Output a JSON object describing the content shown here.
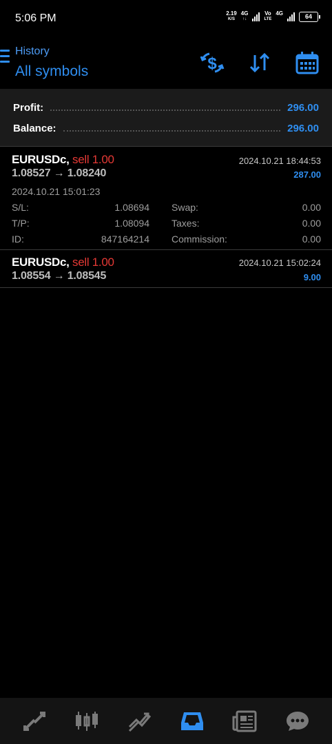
{
  "status": {
    "time": "5:06 PM",
    "speed_value": "2.19",
    "speed_unit": "K/S",
    "net1": "4G",
    "net2_top": "Vo",
    "net2_bottom": "LTE",
    "net3": "4G",
    "battery": "64"
  },
  "header": {
    "subtitle": "History",
    "title": "All symbols",
    "icons": [
      "dollar-exchange-icon",
      "sort-icon",
      "calendar-icon"
    ]
  },
  "summary": {
    "profit_label": "Profit:",
    "profit_value": "296.00",
    "balance_label": "Balance:",
    "balance_value": "296.00"
  },
  "trades": [
    {
      "symbol": "EURUSDc,",
      "side": "sell 1.00",
      "close_time": "2024.10.21 18:44:53",
      "prices": "1.08527 → 1.08240",
      "profit": "287.00",
      "open_time": "2024.10.21 15:01:23",
      "details": {
        "sl_label": "S/L:",
        "sl_value": "1.08694",
        "swap_label": "Swap:",
        "swap_value": "0.00",
        "tp_label": "T/P:",
        "tp_value": "1.08094",
        "taxes_label": "Taxes:",
        "taxes_value": "0.00",
        "id_label": "ID:",
        "id_value": "847164214",
        "commission_label": "Commission:",
        "commission_value": "0.00"
      }
    },
    {
      "symbol": "EURUSDc,",
      "side": "sell 1.00",
      "close_time": "2024.10.21 15:02:24",
      "prices": "1.08554 → 1.08545",
      "profit": "9.00"
    }
  ],
  "bottom_nav": {
    "items": [
      "quotes-icon",
      "chart-icon",
      "trade-icon",
      "history-icon",
      "news-icon",
      "messages-icon"
    ],
    "active": "history-icon"
  },
  "colors": {
    "accent": "#2f8ef0",
    "sell": "#e53935",
    "background": "#000000",
    "panel": "#1b1b1b"
  }
}
